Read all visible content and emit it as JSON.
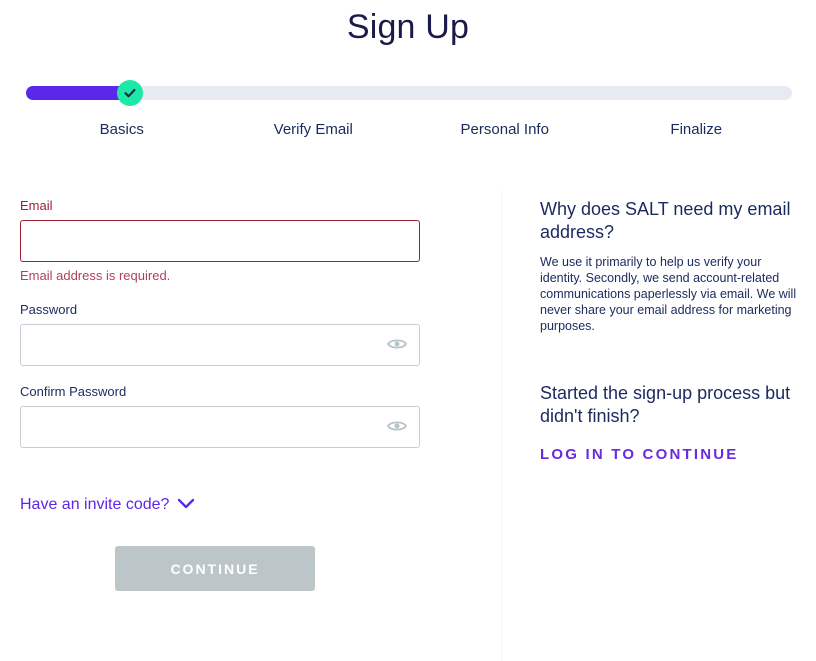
{
  "header": {
    "title": "Sign Up"
  },
  "stepper": {
    "progress_percent": 14.5,
    "current_step_index": 0,
    "check_icon": "check-icon",
    "fill_color": "#5b27e8",
    "track_color": "#e8eaf1",
    "knob_color": "#1ee8a5",
    "steps": [
      {
        "label": "Basics"
      },
      {
        "label": "Verify Email"
      },
      {
        "label": "Personal Info"
      },
      {
        "label": "Finalize"
      }
    ]
  },
  "form": {
    "email": {
      "label": "Email",
      "value": "",
      "placeholder": "",
      "error": "Email address is required.",
      "error_color": "#9d2235"
    },
    "password": {
      "label": "Password",
      "value": "",
      "placeholder": "",
      "toggle_icon": "eye-icon"
    },
    "confirm_password": {
      "label": "Confirm Password",
      "value": "",
      "placeholder": "",
      "toggle_icon": "eye-icon"
    },
    "invite": {
      "label": "Have an invite code?",
      "chevron_icon": "chevron-down-icon",
      "link_color": "#5b27e8"
    },
    "submit": {
      "label": "CONTINUE",
      "disabled": true,
      "disabled_color": "#bcc5c8"
    }
  },
  "side_panel": {
    "email_help": {
      "heading": "Why does SALT need my email address?",
      "body": "We use it primarily to help us verify your identity. Secondly, we send account-related communications paperlessly via email. We will never share your email address for marketing purposes."
    },
    "resume": {
      "heading": "Started the sign-up process but didn't finish?",
      "link_label": "LOG IN TO CONTINUE",
      "link_color": "#6a2ae0"
    }
  }
}
